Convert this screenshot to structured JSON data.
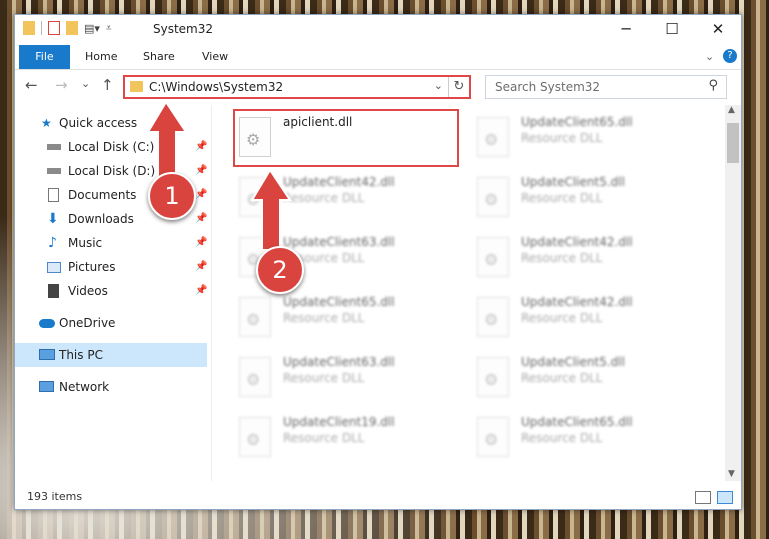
{
  "window": {
    "title": "System32",
    "controls": {
      "minimize": "─",
      "maximize": "☐",
      "close": "✕"
    }
  },
  "ribbon": {
    "tabs": [
      "File",
      "Home",
      "Share",
      "View"
    ],
    "help": "?"
  },
  "navigation": {
    "back": "←",
    "forward": "→",
    "recent": "⌄",
    "up": "↑",
    "address": "C:\\Windows\\System32",
    "dropdown": "⌄",
    "refresh": "↻",
    "search_placeholder": "Search System32"
  },
  "sidebar": {
    "items": [
      {
        "label": "Quick access",
        "icon": "star-icon",
        "pinned": false
      },
      {
        "label": "Local Disk (C:)",
        "icon": "drive-icon",
        "pinned": true
      },
      {
        "label": "Local Disk (D:)",
        "icon": "drive-icon",
        "pinned": true
      },
      {
        "label": "Documents",
        "icon": "documents-icon",
        "pinned": true
      },
      {
        "label": "Downloads",
        "icon": "download-icon",
        "pinned": true
      },
      {
        "label": "Music",
        "icon": "music-icon",
        "pinned": true
      },
      {
        "label": "Pictures",
        "icon": "pictures-icon",
        "pinned": true
      },
      {
        "label": "Videos",
        "icon": "videos-icon",
        "pinned": true
      },
      {
        "label": "OneDrive",
        "icon": "cloud-icon",
        "pinned": false
      },
      {
        "label": "This PC",
        "icon": "computer-icon",
        "pinned": false,
        "selected": true
      },
      {
        "label": "Network",
        "icon": "network-icon",
        "pinned": false
      }
    ]
  },
  "files": [
    {
      "name": "apiclient.dll",
      "type": "",
      "highlighted": true
    },
    {
      "name": "UpdateClient65.dll",
      "type": "Resource DLL"
    },
    {
      "name": "UpdateClient42.dll",
      "type": "Resource DLL"
    },
    {
      "name": "UpdateClient5.dll",
      "type": "Resource DLL"
    },
    {
      "name": "UpdateClient63.dll",
      "type": "Resource DLL"
    },
    {
      "name": "UpdateClient42.dll",
      "type": "Resource DLL"
    },
    {
      "name": "UpdateClient65.dll",
      "type": "Resource DLL"
    },
    {
      "name": "UpdateClient42.dll",
      "type": "Resource DLL"
    },
    {
      "name": "UpdateClient63.dll",
      "type": "Resource DLL"
    },
    {
      "name": "UpdateClient5.dll",
      "type": "Resource DLL"
    },
    {
      "name": "UpdateClient19.dll",
      "type": "Resource DLL"
    },
    {
      "name": "UpdateClient65.dll",
      "type": "Resource DLL"
    }
  ],
  "annotations": {
    "step1": "1",
    "step2": "2"
  },
  "status": {
    "item_count": "193 items"
  },
  "colors": {
    "accent": "#1979ca",
    "highlight": "#e04848",
    "badge": "#d9443f"
  }
}
